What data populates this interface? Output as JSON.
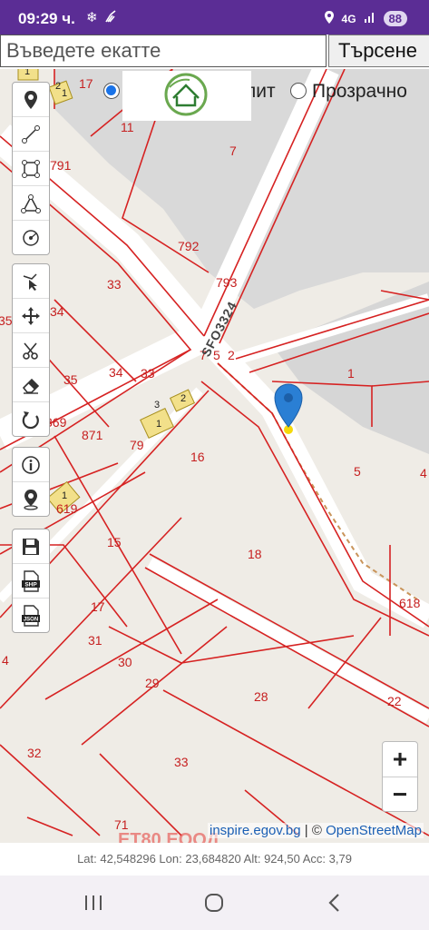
{
  "status_bar": {
    "time": "09:29 ч.",
    "network": "4G",
    "battery": "88",
    "icons": [
      "snowflake-icon",
      "broom-icon",
      "location-icon",
      "signal-icon"
    ]
  },
  "search": {
    "placeholder": "Въведете екатте",
    "button_label": "Търсене"
  },
  "layers": {
    "option1_label": "",
    "option2_label": "лит",
    "option3_label": "Прозрачно",
    "selected": "option1"
  },
  "toolbar": {
    "group1": [
      "marker-icon",
      "line-icon",
      "polygon-icon",
      "polyline-icon",
      "circle-icon"
    ],
    "group2": [
      "vertex-edit-icon",
      "move-icon",
      "cut-icon",
      "eraser-icon",
      "rotate-icon"
    ],
    "group3": [
      "info-icon",
      "locate-pin-icon"
    ],
    "group4": [
      "save-icon",
      "export-shp-icon",
      "export-json-icon"
    ],
    "shp_label": "SHP",
    "json_label": "JSON"
  },
  "map": {
    "road_label": "SFO3324",
    "parcel_labels": [
      {
        "text": "17"
      },
      {
        "text": "11"
      },
      {
        "text": "7"
      },
      {
        "text": "791"
      },
      {
        "text": "792"
      },
      {
        "text": "793"
      },
      {
        "text": "33"
      },
      {
        "text": "34"
      },
      {
        "text": "35"
      },
      {
        "text": "34"
      },
      {
        "text": "33"
      },
      {
        "text": "35"
      },
      {
        "text": "7"
      },
      {
        "text": "5"
      },
      {
        "text": "2"
      },
      {
        "text": "1"
      },
      {
        "text": "369"
      },
      {
        "text": "871"
      },
      {
        "text": "79"
      },
      {
        "text": "16"
      },
      {
        "text": "5"
      },
      {
        "text": "4"
      },
      {
        "text": "619"
      },
      {
        "text": "15"
      },
      {
        "text": "18"
      },
      {
        "text": "618"
      },
      {
        "text": "17"
      },
      {
        "text": "31"
      },
      {
        "text": "30"
      },
      {
        "text": "29"
      },
      {
        "text": "28"
      },
      {
        "text": "22"
      },
      {
        "text": "4"
      },
      {
        "text": "32"
      },
      {
        "text": "33"
      },
      {
        "text": "71"
      }
    ],
    "building_labels": [
      {
        "text": "1"
      },
      {
        "text": "2"
      },
      {
        "text": "1"
      },
      {
        "text": "3"
      },
      {
        "text": "2"
      },
      {
        "text": "1"
      },
      {
        "text": "1"
      }
    ],
    "zoom_in": "+",
    "zoom_out": "−",
    "attribution_source": "inspire.egov.bg",
    "attribution_sep": "| ©",
    "attribution_osm": "OpenStreetMap",
    "watermark": "ЕТ80 ЕООД",
    "colors": {
      "parcel": "#d62222",
      "road": "#ffffff",
      "pin": "#2a7fd4",
      "building": "#f2e08a"
    }
  },
  "coords": {
    "text": "Lat: 42,548296 Lon: 23,684820 Alt: 924,50 Acc: 3,79"
  }
}
